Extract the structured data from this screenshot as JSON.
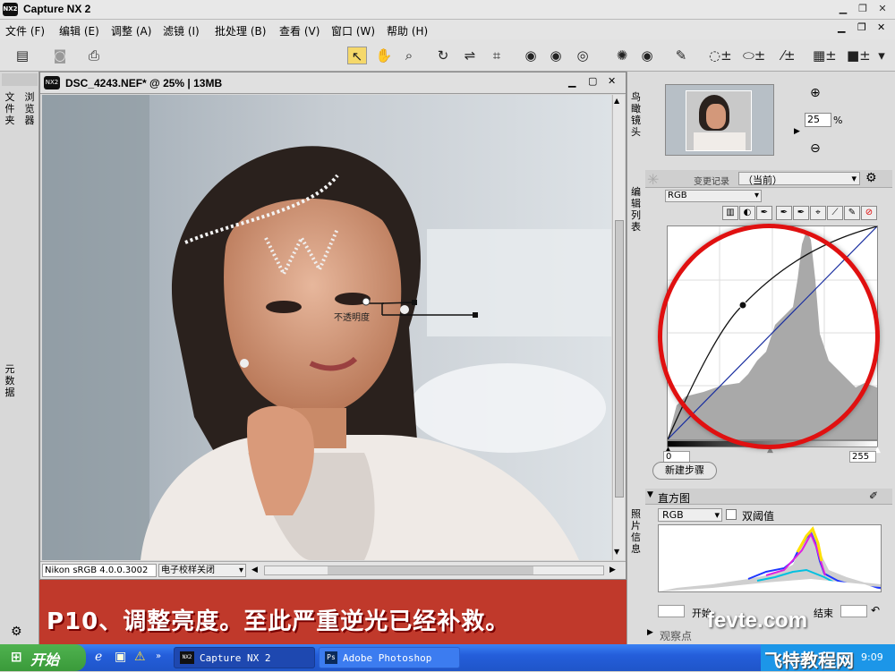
{
  "app": {
    "title": "Capture NX 2",
    "logo": "NX2"
  },
  "menubar": {
    "items": [
      "文件 (F)",
      "编辑 (E)",
      "调整 (A)",
      "滤镜 (I)",
      "批处理 (B)",
      "查看 (V)",
      "窗口 (W)",
      "帮助 (H)"
    ]
  },
  "leftdock": {
    "tab_files": "文件夹",
    "tab_browser": "浏览器",
    "tab_metadata": "元数据"
  },
  "document": {
    "title": "DSC_4243.NEF* @ 25% | 13MB",
    "color_profile": "Nikon sRGB 4.0.0.3002",
    "proof_select": "电子校样关闭",
    "control_point_label": "不透明度"
  },
  "birdseye": {
    "tab_label": "鸟瞰镜头",
    "zoom_value": "25",
    "zoom_unit": "%"
  },
  "editlist": {
    "tab_label": "编辑列表",
    "history_label": "变更记录",
    "history_value": "（当前）",
    "channel": "RGB",
    "range_min": "0",
    "range_max": "255",
    "new_step_button": "新建步骤"
  },
  "photoinfo": {
    "tab_label": "照片信息",
    "histogram_header": "直方图",
    "channel": "RGB",
    "dual_threshold_label": "双阈值",
    "start_label": "开始",
    "end_label": "结束",
    "watch_points": "观察点"
  },
  "caption": {
    "text": "P10、调整亮度。至此严重逆光已经补救。"
  },
  "watermark": {
    "site": "fevte.com",
    "brand": "飞特教程网"
  },
  "taskbar": {
    "start": "开始",
    "tasks": [
      "Capture NX 2",
      "Adobe Photoshop"
    ],
    "clock": "9:09"
  },
  "colors": {
    "highlight_circle": "#e01010",
    "caption_bg": "#c0392b",
    "curve_diagonal": "#1a2fa0",
    "taskbar": "#245edb"
  }
}
